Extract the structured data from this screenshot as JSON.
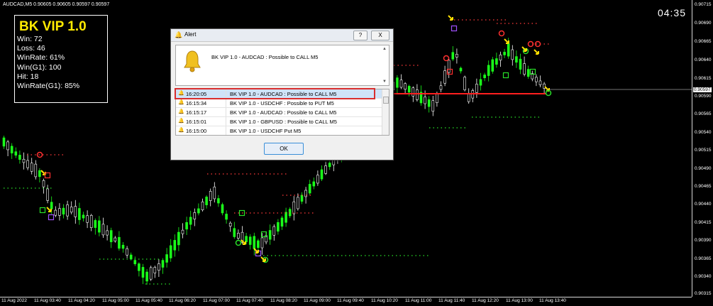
{
  "chart": {
    "symbol_info": "AUDCAD,M5  0.90605 0.90605 0.90597 0.90597",
    "clock": "04:35",
    "current_price": "0.90597",
    "price_labels": [
      "0.90715",
      "0.90690",
      "0.90665",
      "0.90640",
      "0.90615",
      "0.90590",
      "0.90565",
      "0.90540",
      "0.90515",
      "0.90490",
      "0.90465",
      "0.90440",
      "0.90415",
      "0.90390",
      "0.90365",
      "0.90340",
      "0.90315"
    ],
    "time_labels": [
      "11 Aug 2022",
      "11 Aug 03:40",
      "11 Aug 04:20",
      "11 Aug 05:00",
      "11 Aug 05:40",
      "11 Aug 06:20",
      "11 Aug 07:00",
      "11 Aug 07:40",
      "11 Aug 08:20",
      "11 Aug 09:00",
      "11 Aug 09:40",
      "11 Aug 10:20",
      "11 Aug 11:00",
      "11 Aug 11:40",
      "11 Aug 12:20",
      "11 Aug 13:00",
      "11 Aug 13:40"
    ],
    "colors": {
      "up_candle": "#1aff1a",
      "down_candle": "#ffffff",
      "resistance_dots": "#ff3b3b",
      "support_dots": "#28e028",
      "current_line": "#ff1f1f",
      "highlight": "#d92e2e"
    }
  },
  "stats": {
    "title": "BK VIP 1.0",
    "win": "Win: 72",
    "loss": "Loss: 46",
    "winrate": "WinRate: 61%",
    "win_g1": "Win(G1): 100",
    "hit": "Hit: 18",
    "winrate_g1": "WinRate(G1): 85%"
  },
  "alert": {
    "title": "Alert",
    "help_label": "?",
    "close_label": "X",
    "message": "BK VIP 1.0 - AUDCAD : Possible to CALL M5",
    "rows": [
      {
        "time": "16:20:05",
        "message": "BK VIP 1.0 - AUDCAD : Possible to CALL M5"
      },
      {
        "time": "16:15:34",
        "message": "BK VIP 1.0 - USDCHF : Possible to PUT M5"
      },
      {
        "time": "16:15:17",
        "message": "BK VIP 1.0 - AUDCAD : Possible to CALL M5"
      },
      {
        "time": "16:15:01",
        "message": "BK VIP 1.0 - GBPUSD : Possible to CALL M5"
      },
      {
        "time": "16:15:00",
        "message": "BK VIP 1.0 - USDCHF Put M5"
      }
    ],
    "ok_label": "OK",
    "icons": {
      "title": "bell-icon",
      "message": "bell-icon",
      "row": "bell-icon"
    }
  }
}
